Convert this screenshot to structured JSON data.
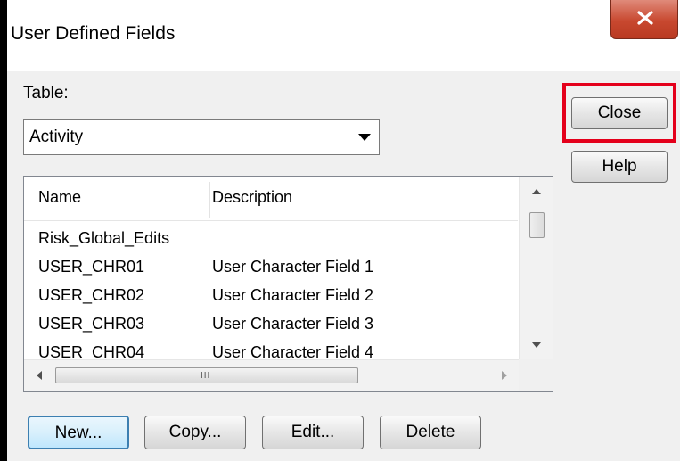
{
  "window": {
    "title": "User Defined Fields"
  },
  "table_label": "Table:",
  "table_select": {
    "value": "Activity"
  },
  "buttons": {
    "close": "Close",
    "help": "Help",
    "new": "New...",
    "copy": "Copy...",
    "edit": "Edit...",
    "delete": "Delete"
  },
  "list": {
    "headers": [
      "Name",
      "Description"
    ],
    "rows": [
      {
        "name": "Risk_Global_Edits",
        "description": ""
      },
      {
        "name": "USER_CHR01",
        "description": "User Character Field 1"
      },
      {
        "name": "USER_CHR02",
        "description": "User Character Field 2"
      },
      {
        "name": "USER_CHR03",
        "description": "User Character Field 3"
      },
      {
        "name": "USER_CHR04",
        "description": "User Character Field 4"
      }
    ],
    "hscroll_grip": "III"
  },
  "colors": {
    "highlight_box": "#e4001b",
    "close_x_button": "#c8482f"
  }
}
